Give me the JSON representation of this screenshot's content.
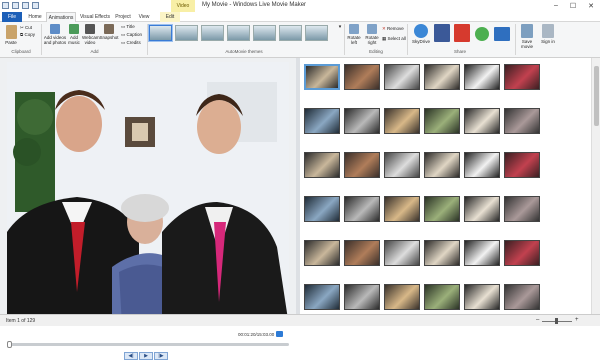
{
  "window": {
    "title": "My Movie - Windows Live Movie Maker",
    "context_tab": "Video Tools",
    "controls": [
      "–",
      "☐",
      "✕"
    ]
  },
  "tabs": [
    "File",
    "Home",
    "Animations",
    "Visual Effects",
    "Project",
    "View",
    "Edit"
  ],
  "ribbon": {
    "clipboard": {
      "paste": "Paste",
      "cut": "Cut",
      "copy": "Copy",
      "label": "Clipboard"
    },
    "add": {
      "add_videos": "Add videos and photos",
      "add_music": "Add music",
      "webcam": "Webcam video",
      "snapshot": "Snapshot",
      "title": "Title",
      "caption": "Caption",
      "credits": "Credits",
      "label": "Add"
    },
    "automovie": {
      "label": "AutoMovie themes"
    },
    "editing": {
      "rotate_left": "Rotate left",
      "rotate_right": "Rotate right",
      "remove": "Remove",
      "select_all": "Select all",
      "label": "Editing"
    },
    "share": {
      "skydrive": "SkyDrive",
      "label": "Share",
      "save_movie": "Save movie",
      "sign_in": "Sign in"
    }
  },
  "preview": {
    "timecode": "00:01:20/15:03.00",
    "player": [
      "◀|",
      "▶",
      "|▶"
    ]
  },
  "status": {
    "text": "Item 1 of 129"
  },
  "colors": {
    "file_tab": "#1c5fb8",
    "accent": "#2d7bd6",
    "context": "#f8efa6"
  }
}
